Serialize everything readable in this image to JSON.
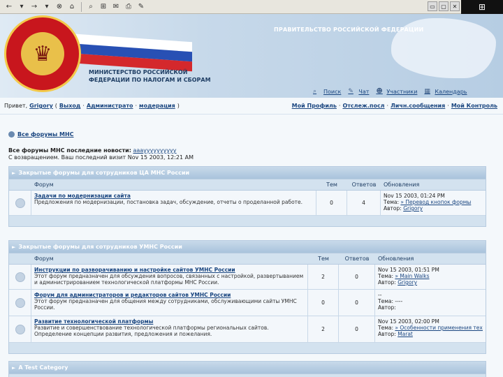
{
  "toolbar": {
    "buttons": [
      "←",
      "▾",
      "→",
      "▾",
      "⊗",
      "⌂",
      "⌕",
      "⊞",
      "✉",
      "⎙",
      "✎"
    ],
    "window_buttons": [
      "▭",
      "▢",
      "✕"
    ]
  },
  "header": {
    "gov_title": "ПРАВИТЕЛЬСТВО РОССИЙСКОЙ ФЕДЕРАЦИИ",
    "ministry_line1": "МИНИСТЕРСТВО РОССИЙСКОЙ",
    "ministry_line2": "ФЕДЕРАЦИИ ПО НАЛОГАМ И СБОРАМ",
    "nav": [
      {
        "label": "Поиск",
        "icon": "search-icon"
      },
      {
        "label": "Чат",
        "icon": "chat-icon"
      },
      {
        "label": "Участники",
        "icon": "users-icon"
      },
      {
        "label": "Календарь",
        "icon": "calendar-icon"
      }
    ]
  },
  "userbar": {
    "greeting": "Привет,",
    "username": "Grigory",
    "logout": "Выход",
    "admin": "Администрато",
    "moderation": "модерация",
    "profile": "Мой Профиль",
    "new_posts": "Отслеж.посл",
    "private_msgs": "Личн.сообщения",
    "my_controls": "Мой Контроль"
  },
  "breadcrumb": "Все форумы МНС",
  "news": {
    "label": "Все форумы МНС последние новости:",
    "text": "ааауууууууууу",
    "line2": "С возвращением. Ваш последний визит Nov 15 2003, 12:21 AM"
  },
  "columns": {
    "forum": "Форум",
    "topics": "Тем",
    "replies": "Ответов",
    "updates": "Обновления"
  },
  "categories": [
    {
      "title": "Закрытые форумы для сотрудников ЦА МНС России",
      "forums": [
        {
          "name": "Задачи по модернизации сайта",
          "desc": "Предложения по модернизации, постановка задач, обсуждение, отчеты о проделанной работе.",
          "topics": "0",
          "replies": "4",
          "last_date": "Nov 15 2003, 01:24 PM",
          "last_topic_label": "Тема:",
          "last_topic": "» Перевод кнопок формы",
          "last_author_label": "Автор:",
          "last_author": "Grigory"
        }
      ]
    },
    {
      "title": "Закрытые форумы для сотрудников УМНС России",
      "forums": [
        {
          "name": "Инструкции по разворачиванию и настройке сайтов УМНС России",
          "desc": "Этот форум предназначен для обсуждения вопросов, связанных с настройкой, развертыванием и администрированием технологической платформы МНС России.",
          "topics": "2",
          "replies": "0",
          "last_date": "Nov 15 2003, 01:51 PM",
          "last_topic_label": "Тема:",
          "last_topic": "» Main Walks",
          "last_author_label": "Автор:",
          "last_author": "Grigory"
        },
        {
          "name": "Форум для администраторов и редакторов сайтов УМНС России",
          "desc": "Этот форум предназначен для общения между сотрудниками, обслуживающими сайты УМНС России.",
          "topics": "0",
          "replies": "0",
          "last_date": "--",
          "last_topic_label": "Тема:",
          "last_topic": "----",
          "last_author_label": "Автор:",
          "last_author": ""
        },
        {
          "name": "Развитие технологической платформы",
          "desc": "Развитие и совершенствование технологической платформы региональных сайтов. Определение концепции развития, предложения и пожелания.",
          "topics": "2",
          "replies": "0",
          "last_date": "Nov 15 2003, 02:00 PM",
          "last_topic_label": "Тема:",
          "last_topic": "» Особенности применения техн...",
          "last_author_label": "Автор:",
          "last_author": "Marat"
        }
      ]
    },
    {
      "title": "A Test Category",
      "forums": []
    }
  ]
}
